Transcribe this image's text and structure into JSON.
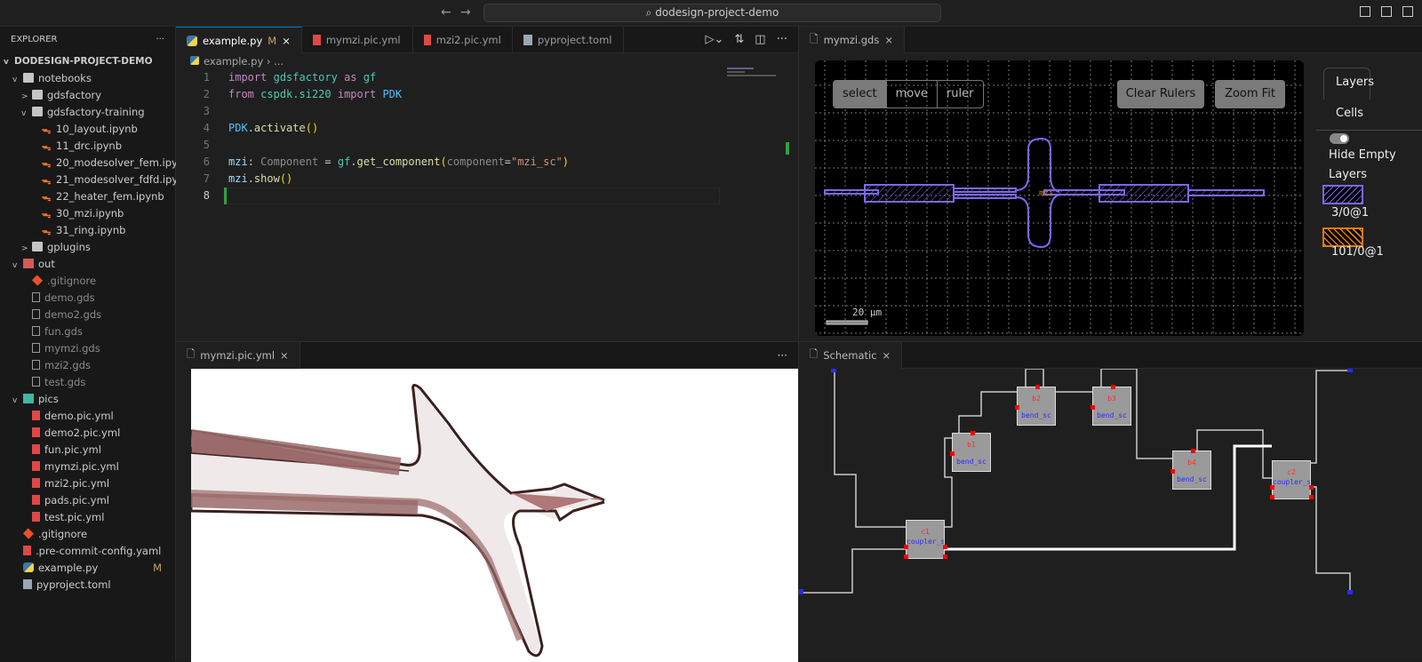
{
  "titlebar": {
    "search": "dodesign-project-demo",
    "back": "←",
    "forward": "→"
  },
  "explorer": {
    "title": "EXPLORER",
    "more": "···",
    "project": "DODESIGN-PROJECT-DEMO",
    "items": [
      {
        "label": "notebooks",
        "type": "folder",
        "indent": 1,
        "chev": "v"
      },
      {
        "label": "gdsfactory",
        "type": "folder",
        "indent": 2,
        "chev": ">"
      },
      {
        "label": "gdsfactory-training",
        "type": "folder",
        "indent": 2,
        "chev": "v"
      },
      {
        "label": "10_layout.ipynb",
        "type": "nb",
        "indent": 3
      },
      {
        "label": "11_drc.ipynb",
        "type": "nb",
        "indent": 3
      },
      {
        "label": "20_modesolver_fem.ipynb",
        "type": "nb",
        "indent": 3
      },
      {
        "label": "21_modesolver_fdfd.ipynb",
        "type": "nb",
        "indent": 3
      },
      {
        "label": "22_heater_fem.ipynb",
        "type": "nb",
        "indent": 3
      },
      {
        "label": "30_mzi.ipynb",
        "type": "nb",
        "indent": 3
      },
      {
        "label": "31_ring.ipynb",
        "type": "nb",
        "indent": 3
      },
      {
        "label": "gplugins",
        "type": "folder",
        "indent": 2,
        "chev": ">"
      },
      {
        "label": "out",
        "type": "redfolder",
        "indent": 1,
        "chev": "v"
      },
      {
        "label": ".gitignore",
        "type": "git",
        "indent": 2,
        "dim": true
      },
      {
        "label": "demo.gds",
        "type": "file",
        "indent": 2,
        "dim": true
      },
      {
        "label": "demo2.gds",
        "type": "file",
        "indent": 2,
        "dim": true
      },
      {
        "label": "fun.gds",
        "type": "file",
        "indent": 2,
        "dim": true
      },
      {
        "label": "mymzi.gds",
        "type": "file",
        "indent": 2,
        "dim": true
      },
      {
        "label": "mzi2.gds",
        "type": "file",
        "indent": 2,
        "dim": true
      },
      {
        "label": "test.gds",
        "type": "file",
        "indent": 2,
        "dim": true
      },
      {
        "label": "pics",
        "type": "tealfolder",
        "indent": 1,
        "chev": "v"
      },
      {
        "label": "demo.pic.yml",
        "type": "yml",
        "indent": 2
      },
      {
        "label": "demo2.pic.yml",
        "type": "yml",
        "indent": 2
      },
      {
        "label": "fun.pic.yml",
        "type": "yml",
        "indent": 2
      },
      {
        "label": "mymzi.pic.yml",
        "type": "yml",
        "indent": 2
      },
      {
        "label": "mzi2.pic.yml",
        "type": "yml",
        "indent": 2
      },
      {
        "label": "pads.pic.yml",
        "type": "yml",
        "indent": 2
      },
      {
        "label": "test.pic.yml",
        "type": "yml",
        "indent": 2
      },
      {
        "label": ".gitignore",
        "type": "git",
        "indent": 1
      },
      {
        "label": ".pre-commit-config.yaml",
        "type": "yml",
        "indent": 1
      },
      {
        "label": "example.py",
        "type": "py",
        "indent": 1,
        "mark": "M"
      },
      {
        "label": "pyproject.toml",
        "type": "toml",
        "indent": 1
      }
    ]
  },
  "editor": {
    "tabs": [
      {
        "label": "example.py",
        "mark": "M",
        "close": "×"
      },
      {
        "label": "mymzi.pic.yml"
      },
      {
        "label": "mzi2.pic.yml"
      },
      {
        "label": "pyproject.toml"
      }
    ],
    "breadcrumb": {
      "file": "example.py",
      "rest": "› ..."
    },
    "line_numbers": [
      "1",
      "2",
      "3",
      "4",
      "5",
      "6",
      "7",
      "8"
    ]
  },
  "gds": {
    "tab": "mymzi.gds",
    "close": "×",
    "tools": [
      "select",
      "move",
      "ruler"
    ],
    "clear_rulers": "Clear Rulers",
    "zoom_fit": "Zoom Fit",
    "cell_label": "mzi",
    "scale": "20 µm",
    "panel": {
      "tab_layers": "Layers",
      "tab_cells": "Cells",
      "hide_empty": "Hide Empty Layers",
      "layers": [
        {
          "name": "3/0@1",
          "color": "#7b68ee"
        },
        {
          "name": "101/0@1",
          "color": "#e07a10"
        }
      ]
    }
  },
  "yaml_view": {
    "tab": "mymzi.pic.yml",
    "close": "×",
    "more": "···"
  },
  "schematic": {
    "tab": "Schematic",
    "close": "×",
    "instances": [
      {
        "id": "c1",
        "type": "coupler_sc"
      },
      {
        "id": "b1",
        "type": "bend_sc"
      },
      {
        "id": "b2",
        "type": "bend_sc"
      },
      {
        "id": "b3",
        "type": "bend_sc"
      },
      {
        "id": "b4",
        "type": "bend_sc"
      },
      {
        "id": "c2",
        "type": "coupler_sc"
      }
    ]
  }
}
